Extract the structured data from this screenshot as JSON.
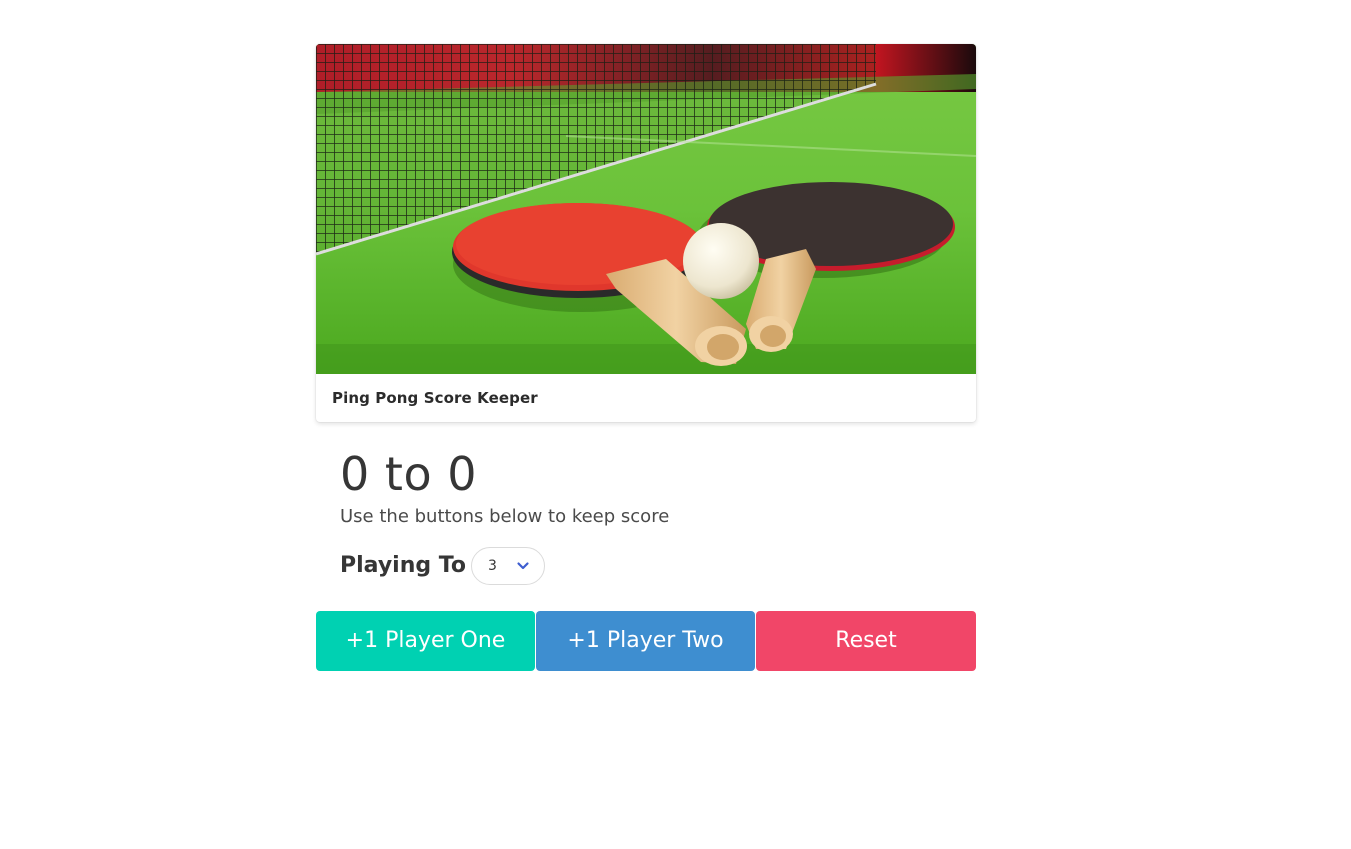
{
  "card": {
    "image_alt": "ping-pong-paddles-photo",
    "footer_title": "Ping Pong Score Keeper"
  },
  "score": {
    "player_one": "0",
    "separator": "to",
    "player_two": "0",
    "display": "0 to 0"
  },
  "subtitle": "Use the buttons below to keep score",
  "playing_to": {
    "label": "Playing To",
    "selected": "3"
  },
  "buttons": {
    "player_one": "+1 Player One",
    "player_two": "+1 Player Two",
    "reset": "Reset"
  },
  "colors": {
    "player_one": "#00d1b2",
    "player_two": "#3e8ed0",
    "reset": "#f14668",
    "chevron": "#3e5ed0"
  }
}
